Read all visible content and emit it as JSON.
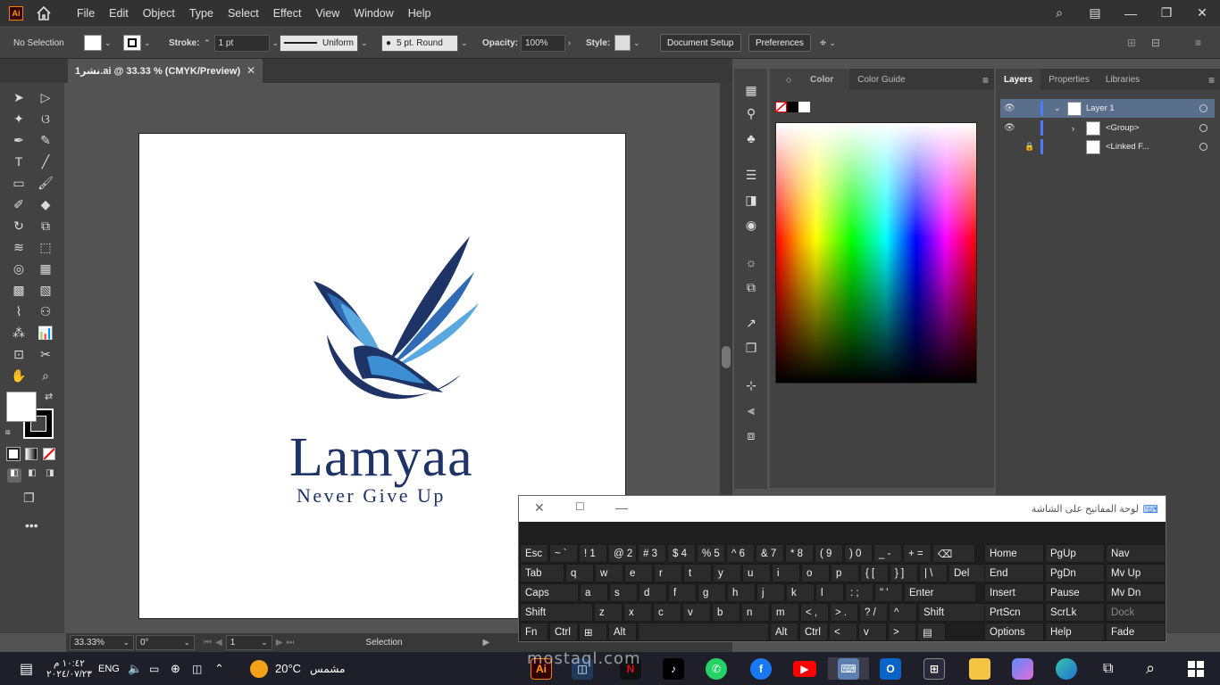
{
  "menubar": {
    "app_logo": "Ai",
    "menus": [
      "File",
      "Edit",
      "Object",
      "Type",
      "Select",
      "Effect",
      "View",
      "Window",
      "Help"
    ]
  },
  "controlbar": {
    "selection": "No Selection",
    "stroke_label": "Stroke:",
    "stroke_value": "1 pt",
    "stroke_profile": "Uniform",
    "brush": "5 pt. Round",
    "opacity_label": "Opacity:",
    "opacity_value": "100%",
    "style_label": "Style:",
    "document_setup": "Document Setup",
    "preferences": "Preferences"
  },
  "document": {
    "tab_title": "نشر1.ai @ 33.33 % (CMYK/Preview)"
  },
  "artboard": {
    "logo_name": "Lamyaa",
    "logo_tagline": "Never Give Up",
    "colors": {
      "dark": "#1e3366",
      "mid": "#2e6bb4",
      "light": "#5aa8e0"
    }
  },
  "statusbar": {
    "zoom": "33.33%",
    "rotation": "0°",
    "artboard_number": "1",
    "tool_name": "Selection"
  },
  "color_panel": {
    "tabs": [
      "Color",
      "Color Guide"
    ]
  },
  "layers_panel": {
    "tabs": [
      "Layers",
      "Properties",
      "Libraries"
    ],
    "rows": [
      {
        "label": "Layer 1"
      },
      {
        "label": "<Group>"
      },
      {
        "label": "<Linked F..."
      }
    ]
  },
  "osk": {
    "title": "لوحة المفاتيح على الشاشة",
    "rows": [
      [
        "Esc",
        "~ `",
        "! 1",
        "@ 2",
        "# 3",
        "$ 4",
        "% 5",
        "^ 6",
        "& 7",
        "* 8",
        "( 9",
        ") 0",
        "_ -",
        "+ =",
        "⌫"
      ],
      [
        "Tab",
        "q",
        "w",
        "e",
        "r",
        "t",
        "y",
        "u",
        "i",
        "o",
        "p",
        "{ [",
        "} ]",
        "| \\",
        "Del"
      ],
      [
        "Caps",
        "a",
        "s",
        "d",
        "f",
        "g",
        "h",
        "j",
        "k",
        "l",
        ": ;",
        "\" '",
        "Enter"
      ],
      [
        "Shift",
        "z",
        "x",
        "c",
        "v",
        "b",
        "n",
        "m",
        "< ,",
        "> .",
        "? /",
        "^",
        "Shift"
      ],
      [
        "Fn",
        "Ctrl",
        "⊞",
        "Alt",
        "",
        "Alt",
        "Ctrl",
        "<",
        "v",
        ">",
        "▤"
      ]
    ],
    "nav": [
      [
        "Home",
        "PgUp",
        "Nav"
      ],
      [
        "End",
        "PgDn",
        "Mv Up"
      ],
      [
        "Insert",
        "Pause",
        "Mv Dn"
      ],
      [
        "PrtScn",
        "ScrLk",
        "Dock"
      ],
      [
        "Options",
        "Help",
        "Fade"
      ]
    ]
  },
  "taskbar": {
    "time": "١٠:٤٢ م",
    "date": "٢٠٢٤/٠٧/٢٣",
    "language": "ENG",
    "temperature": "20°C",
    "weather": "مشمس",
    "watermark": "mostaql.com"
  }
}
